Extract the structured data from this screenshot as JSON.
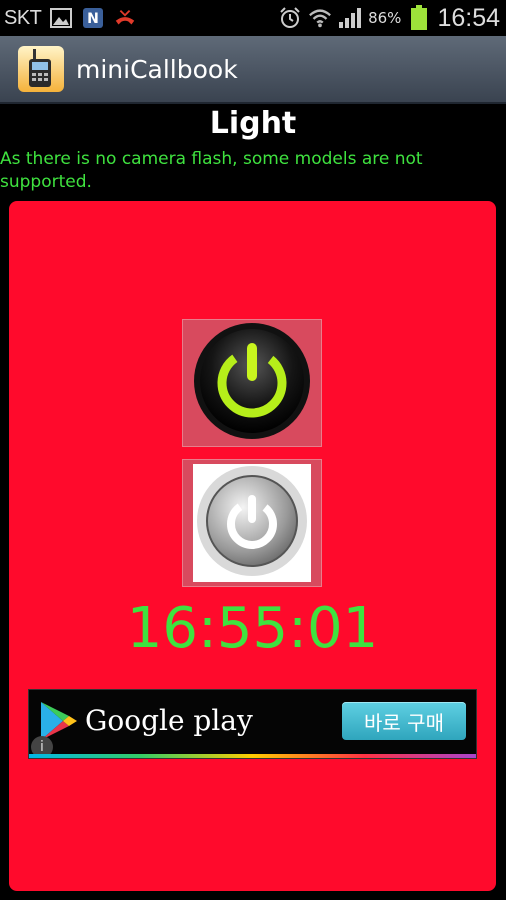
{
  "status_bar": {
    "carrier": "SKT",
    "battery": "86%",
    "time": "16:54",
    "icons": [
      "gallery-icon",
      "naver-icon",
      "missed-call-icon",
      "alarm-icon",
      "wifi-icon",
      "signal-icon",
      "battery-icon"
    ]
  },
  "app_bar": {
    "title": "miniCallbook",
    "icon": "walkie-talkie-icon"
  },
  "content": {
    "title": "Light",
    "notice": "As there is no camera flash, some models are not supported.",
    "clock": "16:55:01"
  },
  "ad": {
    "brand": "Google play",
    "button": "바로 구매",
    "info": "i"
  },
  "colors": {
    "panel": "#ff0a2c",
    "accent_green": "#3fe23f"
  }
}
